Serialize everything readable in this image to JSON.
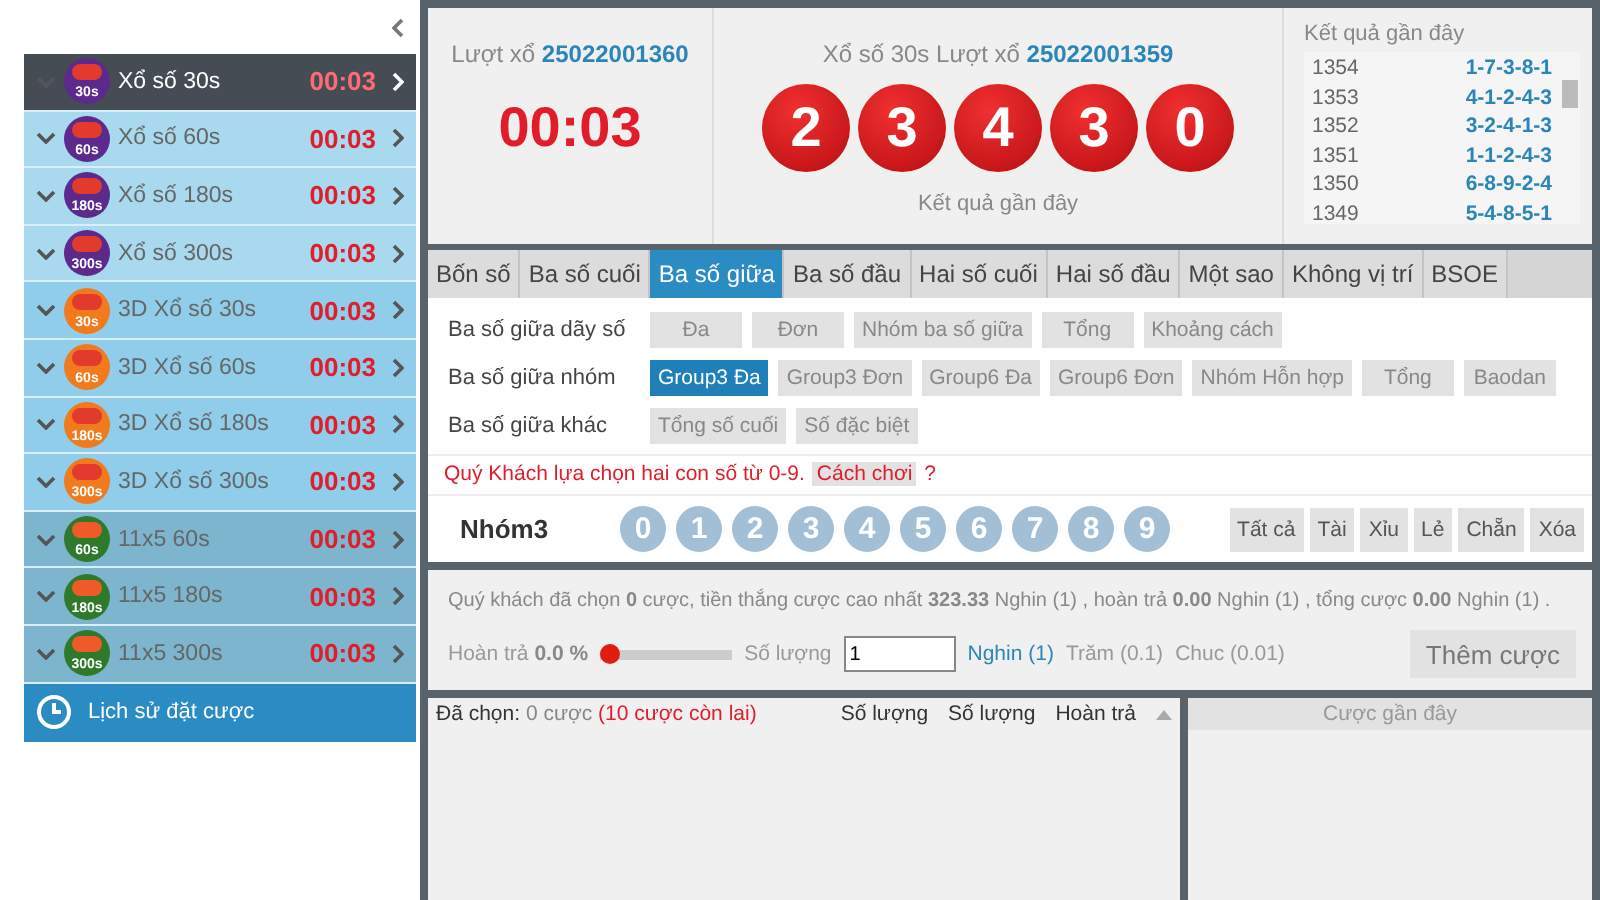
{
  "sidebar": {
    "items": [
      {
        "name": "Xổ số 30s",
        "kind": "lotto",
        "badge": "30s",
        "timer": "00:03",
        "selected": true
      },
      {
        "name": "Xổ số 60s",
        "kind": "lotto",
        "badge": "60s",
        "timer": "00:03",
        "selected": false
      },
      {
        "name": "Xổ số 180s",
        "kind": "lotto",
        "badge": "180s",
        "timer": "00:03",
        "selected": false
      },
      {
        "name": "Xổ số 300s",
        "kind": "lotto",
        "badge": "300s",
        "timer": "00:03",
        "selected": false
      },
      {
        "name": "3D Xổ số 30s",
        "kind": "threed",
        "badge": "30s",
        "timer": "00:03",
        "selected": false
      },
      {
        "name": "3D Xổ số 60s",
        "kind": "threed",
        "badge": "60s",
        "timer": "00:03",
        "selected": false
      },
      {
        "name": "3D Xổ số 180s",
        "kind": "threed",
        "badge": "180s",
        "timer": "00:03",
        "selected": false
      },
      {
        "name": "3D Xổ số 300s",
        "kind": "threed",
        "badge": "300s",
        "timer": "00:03",
        "selected": false
      },
      {
        "name": "11x5 60s",
        "kind": "elevenfive",
        "badge": "60s",
        "timer": "00:03",
        "selected": false
      },
      {
        "name": "11x5 180s",
        "kind": "elevenfive",
        "badge": "180s",
        "timer": "00:03",
        "selected": false
      },
      {
        "name": "11x5 300s",
        "kind": "elevenfive",
        "badge": "300s",
        "timer": "00:03",
        "selected": false
      }
    ],
    "history": "Lịch sử đặt cược"
  },
  "current": {
    "label": "Lượt xổ",
    "round": "25022001360",
    "countdown": "00:03"
  },
  "last_draw": {
    "label": "Xổ số 30s Lượt xổ",
    "round": "25022001359",
    "balls": [
      "2",
      "3",
      "4",
      "3",
      "0"
    ],
    "caption": "Kết quả gần đây"
  },
  "recent": {
    "title": "Kết quả gần đây",
    "rows": [
      {
        "round": "1354",
        "result": "1-7-3-8-1"
      },
      {
        "round": "1353",
        "result": "4-1-2-4-3"
      },
      {
        "round": "1352",
        "result": "3-2-4-1-3"
      },
      {
        "round": "1351",
        "result": "1-1-2-4-3"
      },
      {
        "round": "1350",
        "result": "6-8-9-2-4"
      },
      {
        "round": "1349",
        "result": "5-4-8-5-1"
      }
    ]
  },
  "tabs": [
    {
      "label": "Bốn số",
      "selected": false
    },
    {
      "label": "Ba số cuối",
      "selected": false
    },
    {
      "label": "Ba số giữa",
      "selected": true
    },
    {
      "label": "Ba số đầu",
      "selected": false
    },
    {
      "label": "Hai số cuối",
      "selected": false
    },
    {
      "label": "Hai số đầu",
      "selected": false
    },
    {
      "label": "Một sao",
      "selected": false
    },
    {
      "label": "Không vị trí",
      "selected": false
    },
    {
      "label": "BSOE",
      "selected": false
    }
  ],
  "option_groups": [
    {
      "label": "Ba số giữa dãy số",
      "options": [
        {
          "label": "Đa",
          "selected": false
        },
        {
          "label": "Đơn",
          "selected": false
        },
        {
          "label": "Nhóm ba số giữa",
          "selected": false
        },
        {
          "label": "Tổng",
          "selected": false
        },
        {
          "label": "Khoảng cách",
          "selected": false
        }
      ]
    },
    {
      "label": "Ba số giữa nhóm",
      "options": [
        {
          "label": "Group3 Đa",
          "selected": true
        },
        {
          "label": "Group3 Đơn",
          "selected": false
        },
        {
          "label": "Group6 Đa",
          "selected": false
        },
        {
          "label": "Group6 Đơn",
          "selected": false
        },
        {
          "label": "Nhóm Hỗn hợp",
          "selected": false
        },
        {
          "label": "Tổng",
          "selected": false
        },
        {
          "label": "Baodan",
          "selected": false
        }
      ]
    },
    {
      "label": "Ba số giữa khác",
      "options": [
        {
          "label": "Tổng số cuối",
          "selected": false
        },
        {
          "label": "Số đặc biệt",
          "selected": false
        }
      ]
    }
  ],
  "hint": {
    "text": "Quý Khách lựa chọn hai con số từ 0-9.",
    "link": "Cách chơi",
    "mark": "?"
  },
  "picker": {
    "label": "Nhóm3",
    "numbers": [
      {
        "label": "0",
        "selected": false
      },
      {
        "label": "1",
        "selected": false
      },
      {
        "label": "2",
        "selected": false
      },
      {
        "label": "3",
        "selected": false
      },
      {
        "label": "4",
        "selected": false
      },
      {
        "label": "5",
        "selected": false
      },
      {
        "label": "6",
        "selected": false
      },
      {
        "label": "7",
        "selected": false
      },
      {
        "label": "8",
        "selected": false
      },
      {
        "label": "9",
        "selected": false
      }
    ],
    "quick": [
      "Tất cả",
      "Tài",
      "Xỉu",
      "Lẻ",
      "Chẵn",
      "Xóa"
    ]
  },
  "summary": {
    "text": "Quý khách đã chọn **0** cược, tiền thắng cược cao nhất **323.33** Nghin (1) , hoàn trả **0.00** Nghin (1) , tổng cược **0.00** Nghin (1) ."
  },
  "rebate": {
    "label": "Hoàn trả",
    "value": "0.0 %",
    "level": 0
  },
  "quantity": {
    "label": "Số lượng",
    "value": "1"
  },
  "units": [
    {
      "label": "Nghin (1)",
      "selected": true
    },
    {
      "label": "Trăm (0.1)",
      "selected": false
    },
    {
      "label": "Chuc (0.01)",
      "selected": false
    }
  ],
  "add_button": "Thêm cược",
  "bet_list": {
    "chosen_label": "Đã chọn:",
    "chosen": "0 cược",
    "remaining": "(10 cược còn lai)",
    "columns": [
      "Số lượng",
      "Số lượng",
      "Hoàn trả"
    ]
  },
  "recent_bets": {
    "title": "Cược gần đây"
  }
}
